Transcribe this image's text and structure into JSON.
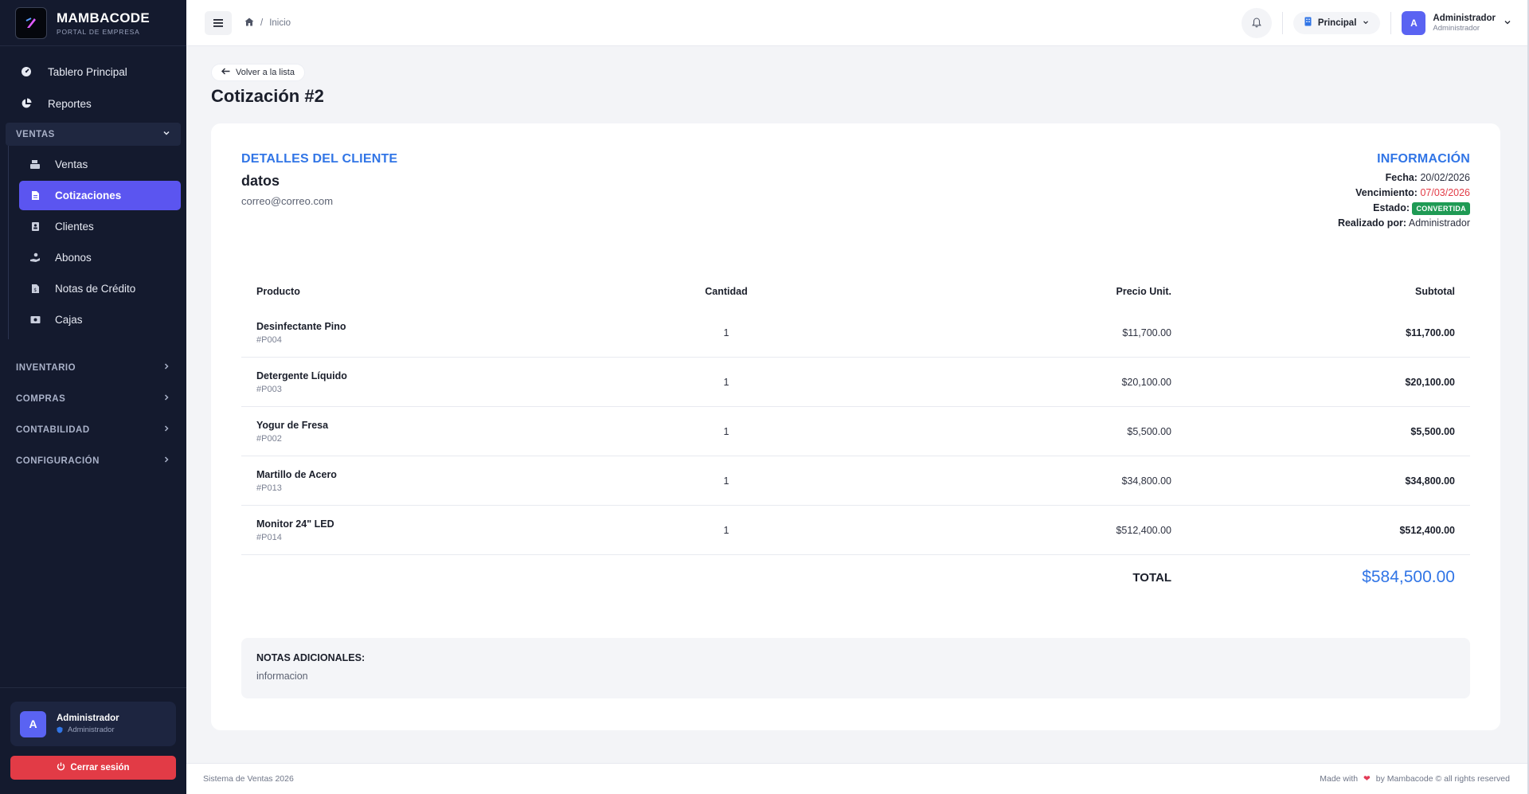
{
  "brand": {
    "name": "MAMBACODE",
    "subtitle": "PORTAL DE EMPRESA"
  },
  "sidebar": {
    "top_items": [
      {
        "label": "Tablero Principal",
        "icon": "dashboard-icon"
      },
      {
        "label": "Reportes",
        "icon": "pie-chart-icon"
      }
    ],
    "open_section": {
      "label": "VENTAS"
    },
    "sub_items": [
      {
        "label": "Ventas",
        "icon": "cash-register-icon"
      },
      {
        "label": "Cotizaciones",
        "icon": "document-icon",
        "active": true
      },
      {
        "label": "Clientes",
        "icon": "contacts-icon"
      },
      {
        "label": "Abonos",
        "icon": "hand-coin-icon"
      },
      {
        "label": "Notas de Crédito",
        "icon": "receipt-icon"
      },
      {
        "label": "Cajas",
        "icon": "cash-box-icon"
      }
    ],
    "collapsed_sections": [
      "INVENTARIO",
      "COMPRAS",
      "CONTABILIDAD",
      "CONFIGURACIÓN"
    ],
    "user": {
      "initial": "A",
      "name": "Administrador",
      "role": "Administrador"
    },
    "logout_label": "Cerrar sesión"
  },
  "topbar": {
    "breadcrumb": "Inicio",
    "branch": "Principal",
    "user": {
      "initial": "A",
      "name": "Administrador",
      "role": "Administrador"
    }
  },
  "page": {
    "back_label": "Volver a la lista",
    "title": "Cotización #2"
  },
  "client": {
    "section_title": "DETALLES DEL CLIENTE",
    "name": "datos",
    "email": "correo@correo.com"
  },
  "info": {
    "section_title": "INFORMACIÓN",
    "fecha_label": "Fecha:",
    "fecha": "20/02/2026",
    "vencimiento_label": "Vencimiento:",
    "vencimiento": "07/03/2026",
    "estado_label": "Estado:",
    "estado": "CONVERTIDA",
    "realizado_label": "Realizado por:",
    "realizado": "Administrador"
  },
  "table": {
    "headers": {
      "producto": "Producto",
      "cantidad": "Cantidad",
      "precio": "Precio Unit.",
      "subtotal": "Subtotal"
    },
    "rows": [
      {
        "name": "Desinfectante Pino",
        "code": "#P004",
        "qty": "1",
        "price": "$11,700.00",
        "subtotal": "$11,700.00"
      },
      {
        "name": "Detergente Líquido",
        "code": "#P003",
        "qty": "1",
        "price": "$20,100.00",
        "subtotal": "$20,100.00"
      },
      {
        "name": "Yogur de Fresa",
        "code": "#P002",
        "qty": "1",
        "price": "$5,500.00",
        "subtotal": "$5,500.00"
      },
      {
        "name": "Martillo de Acero",
        "code": "#P013",
        "qty": "1",
        "price": "$34,800.00",
        "subtotal": "$34,800.00"
      },
      {
        "name": "Monitor 24\" LED",
        "code": "#P014",
        "qty": "1",
        "price": "$512,400.00",
        "subtotal": "$512,400.00"
      }
    ],
    "total_label": "TOTAL",
    "total": "$584,500.00"
  },
  "notes": {
    "title": "NOTAS ADICIONALES:",
    "text": "informacion"
  },
  "footer": {
    "left": "Sistema de Ventas 2026",
    "made_with": "Made with",
    "right": "by Mambacode © all rights reserved"
  },
  "colors": {
    "accent": "#5b55f0",
    "link_blue": "#3175e6",
    "danger": "#e23b46",
    "success": "#1f9a54",
    "sidebar_bg": "#141a2e"
  }
}
